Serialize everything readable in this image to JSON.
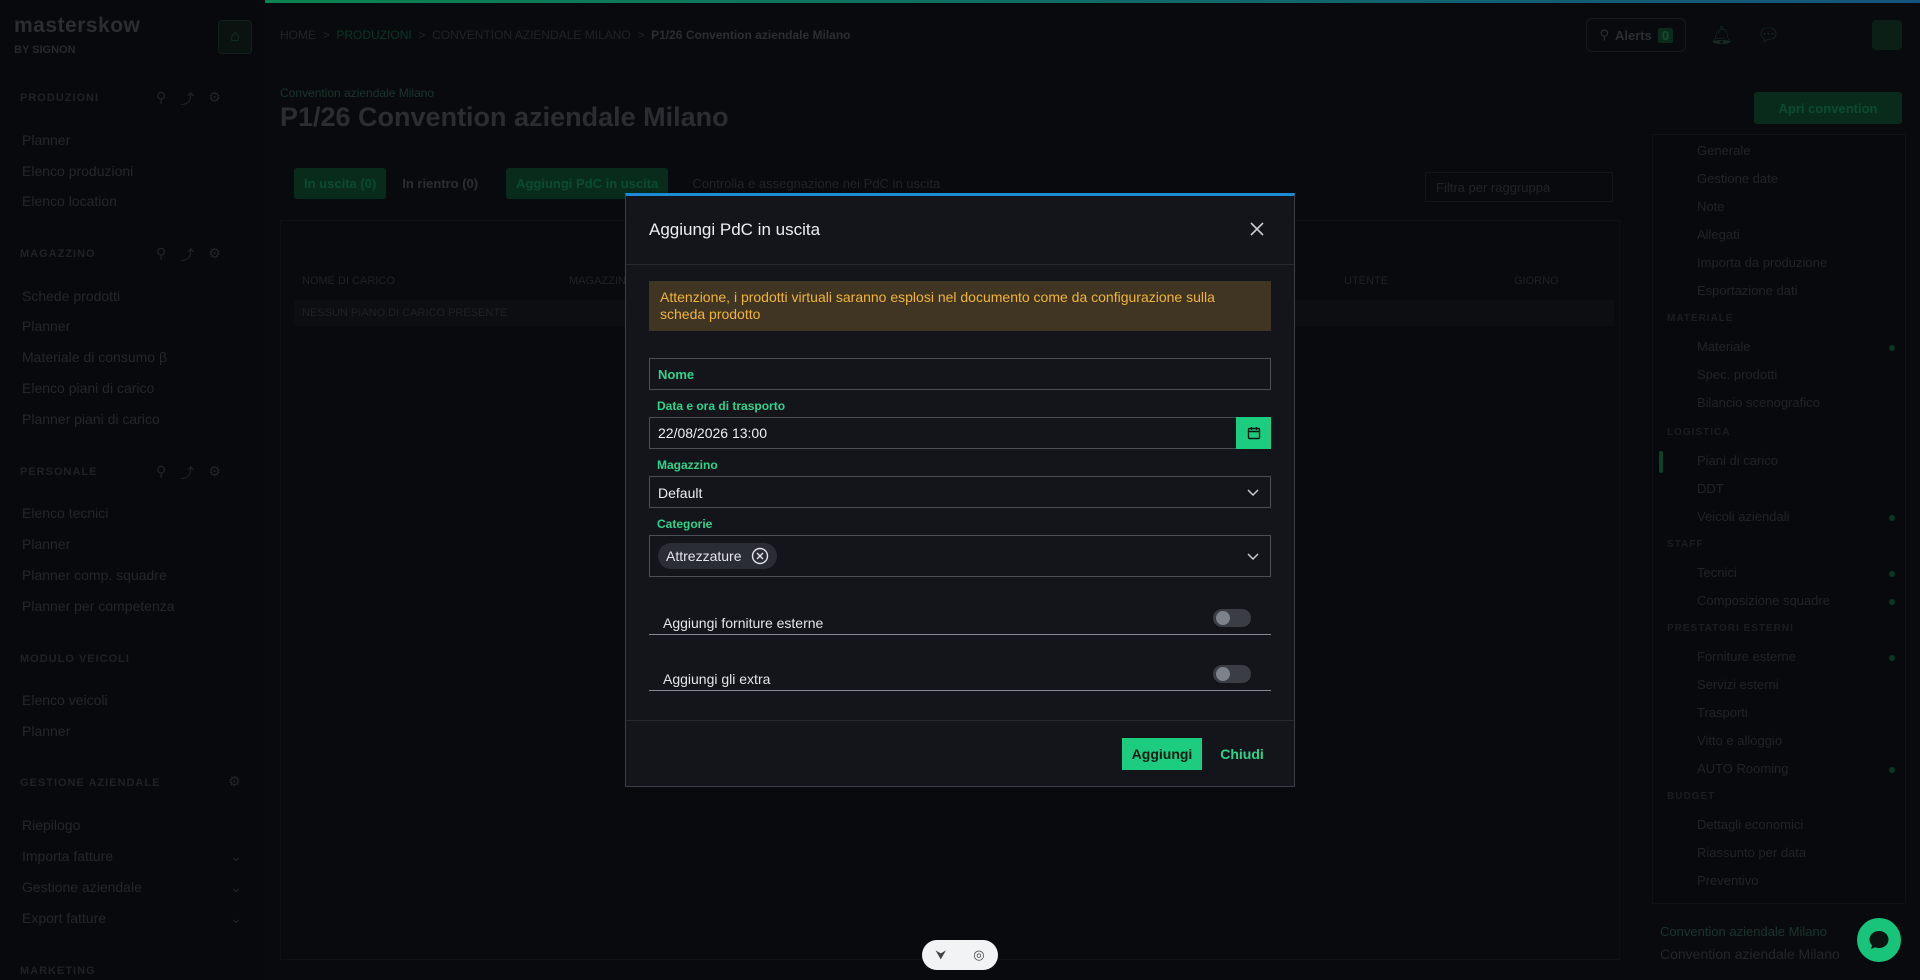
{
  "app": {
    "logo": "masterskow",
    "logo_sub": "BY SIGNON"
  },
  "sidebar": {
    "sections": [
      {
        "title": "PRODUZIONI",
        "items": [
          "Planner",
          "Elenco produzioni",
          "Elenco location"
        ]
      },
      {
        "title": "MAGAZZINO",
        "items": [
          "Schede prodotti",
          "Planner",
          "Materiale di consumo β",
          "Elenco piani di carico",
          "Planner piani di carico"
        ]
      },
      {
        "title": "PERSONALE",
        "items": [
          "Elenco tecnici",
          "Planner",
          "Planner comp. squadre",
          "Planner per competenza"
        ]
      },
      {
        "title": "MODULO VEICOLI",
        "items": [
          "Elenco veicoli",
          "Planner"
        ]
      },
      {
        "title": "GESTIONE AZIENDALE",
        "items": [
          "Riepilogo",
          "Importa fatture",
          "Gestione aziendale",
          "Export fatture"
        ]
      },
      {
        "title": "MARKETING",
        "items": []
      }
    ]
  },
  "header": {
    "breadcrumb": {
      "home": "HOME",
      "sep": ">",
      "section": "PRODUZIONI",
      "event": "CONVENTION AZIENDALE MILANO",
      "current": "P1/26 Convention aziendale Milano"
    },
    "alerts_label": "Alerts",
    "alerts_count": "0"
  },
  "page": {
    "subtitle": "Convention aziendale Milano",
    "title": "P1/26 Convention aziendale Milano",
    "edit_button": "Apri convention",
    "tabs": [
      "In uscita (0)",
      "In rientro (0)"
    ],
    "add_tab": "Aggiungi PdC in uscita",
    "control_link": "Controlla e assegnazione nei PdC in uscita",
    "filter_placeholder": "Filtra per raggruppa",
    "table_headers": [
      "NOME DI CARICO",
      "MAGAZZINO",
      "UTENTE",
      "GIORNO"
    ],
    "empty_row": "NESSUN PIANO DI CARICO PRESENTE"
  },
  "right_panel": {
    "items_a": [
      "Generale",
      "Gestione date",
      "Note",
      "Allegati",
      "Importa da produzione",
      "Esportazione dati"
    ],
    "sec_materiale": "MATERIALE",
    "items_b": [
      "Materiale",
      "Spec. prodotti",
      "Bilancio scenografico"
    ],
    "sec_logistica": "LOGISTICA",
    "items_c": [
      "Piani di carico",
      "DDT",
      "Veicoli aziendali"
    ],
    "sec_staff": "STAFF",
    "items_d": [
      "Tecnici",
      "Composizione squadre"
    ],
    "sec_prestatori": "PRESTATORI ESTERNI",
    "items_e": [
      "Forniture esterne",
      "Servizi esterni",
      "Trasporti",
      "Vitto e alloggio",
      "AUTO Rooming"
    ],
    "sec_budget": "BUDGET",
    "items_f": [
      "Dettagli economici",
      "Riassunto per data",
      "Preventivo"
    ],
    "footer_small": "Convention aziendale Milano",
    "footer_big": "Convention aziendale Milano"
  },
  "modal": {
    "title": "Aggiungi PdC in uscita",
    "warning": "Attenzione, i prodotti virtuali saranno esplosi nel documento come da configurazione sulla scheda prodotto",
    "nome_placeholder": "Nome",
    "nome_value": "",
    "date_label": "Data e ora di trasporto",
    "date_value": "22/08/2026 13:00",
    "magazzino_label": "Magazzino",
    "magazzino_value": "Default",
    "categorie_label": "Categorie",
    "categorie_chips": [
      "Attrezzature"
    ],
    "toggle_forniture": "Aggiungi forniture esterne",
    "toggle_extra": "Aggiungi gli extra",
    "add_button": "Aggiungi",
    "close_button": "Chiudi"
  },
  "colors": {
    "accent": "#1ccc7f",
    "label": "#2fd48a",
    "warning_bg": "#3f3522",
    "warning_text": "#f1b43a",
    "modal_top_border": "#1d8cd6"
  }
}
